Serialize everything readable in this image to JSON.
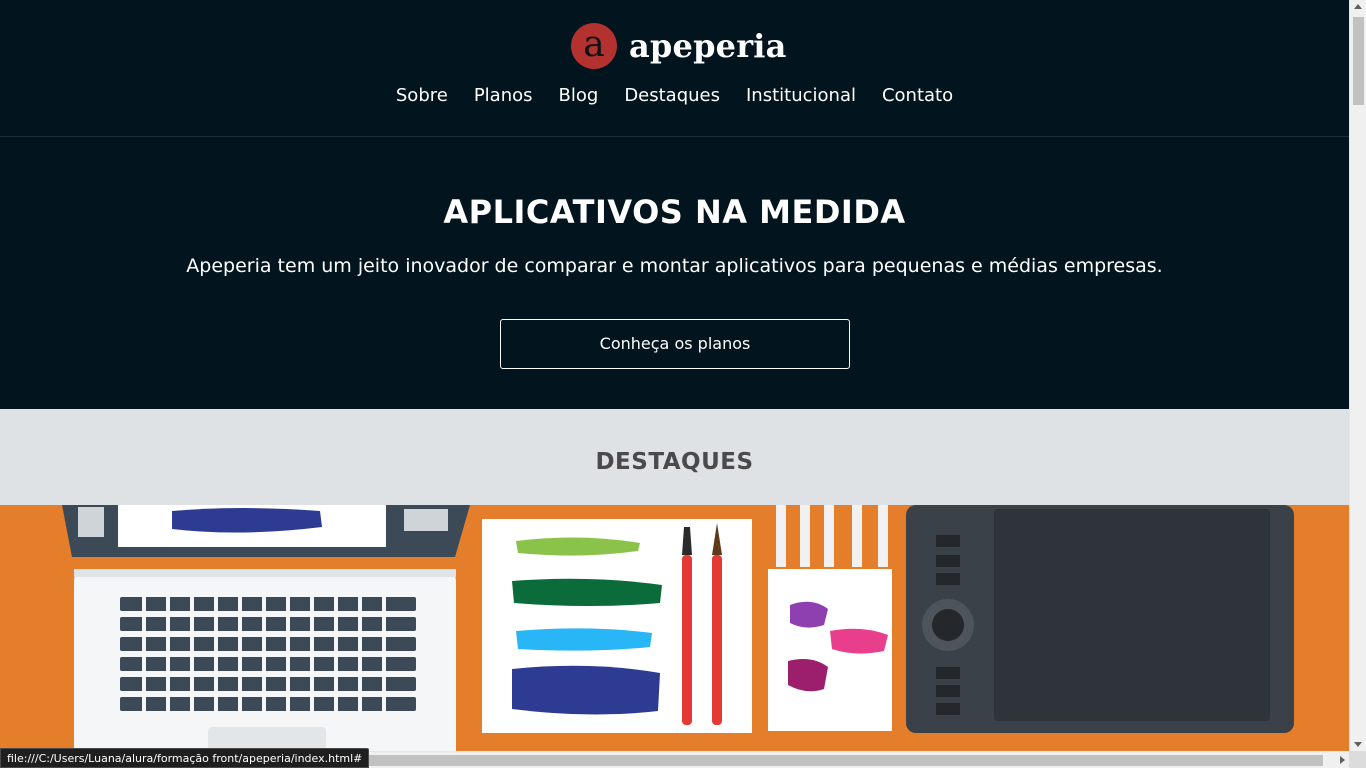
{
  "brand": {
    "badge_letter": "a",
    "name": "apeperia"
  },
  "nav": {
    "items": [
      {
        "label": "Sobre"
      },
      {
        "label": "Planos"
      },
      {
        "label": "Blog"
      },
      {
        "label": "Destaques"
      },
      {
        "label": "Institucional"
      },
      {
        "label": "Contato"
      }
    ]
  },
  "hero": {
    "title": "APLICATIVOS NA MEDIDA",
    "text": "Apeperia tem um jeito inovador de comparar e montar aplicativos para pequenas e médias empresas.",
    "button_label": "Conheça os planos"
  },
  "destaques": {
    "title": "DESTAQUES"
  },
  "banner": {
    "icon": "workspace-illustration",
    "colors": {
      "background": "#e57e2a",
      "laptop": "#3c4956",
      "paper": "#ffffff",
      "tablet": "#3b4148"
    }
  },
  "statusbar": {
    "url": "file:///C:/Users/Luana/alura/formação front/apeperia/index.html#"
  },
  "colors": {
    "header_bg": "#02141d",
    "brand_badge": "#b3322f",
    "destaques_bg": "#dfe2e5"
  }
}
